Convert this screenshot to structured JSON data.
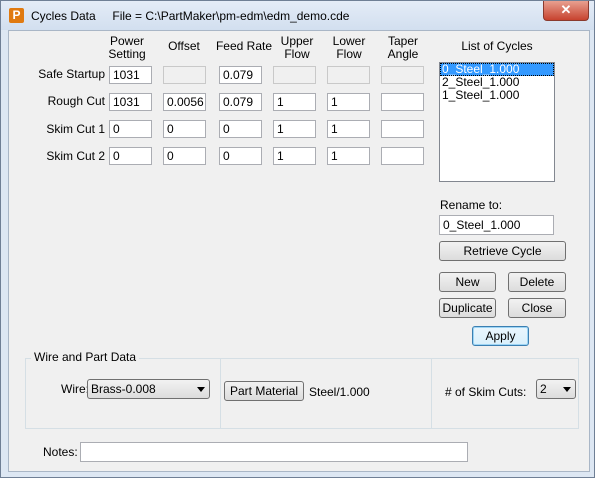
{
  "window": {
    "app_icon": "P",
    "title": "Cycles Data     File = C:\\PartMaker\\pm-edm\\edm_demo.cde",
    "close_glyph": "✕"
  },
  "headers": {
    "power": [
      "Power",
      "Setting"
    ],
    "offset": "Offset",
    "feed_rate": "Feed Rate",
    "upper_flow": [
      "Upper",
      "Flow"
    ],
    "lower_flow": [
      "Lower",
      "Flow"
    ],
    "taper_angle": [
      "Taper",
      "Angle"
    ]
  },
  "rows": [
    {
      "label": "Safe Startup",
      "power": "1031",
      "offset": "",
      "feed_rate": "0.079",
      "upper_flow": "",
      "lower_flow": "",
      "taper_angle": ""
    },
    {
      "label": "Rough Cut",
      "power": "1031",
      "offset": "0.0056",
      "feed_rate": "0.079",
      "upper_flow": "1",
      "lower_flow": "1",
      "taper_angle": ""
    },
    {
      "label": "Skim Cut 1",
      "power": "0",
      "offset": "0",
      "feed_rate": "0",
      "upper_flow": "1",
      "lower_flow": "1",
      "taper_angle": ""
    },
    {
      "label": "Skim Cut 2",
      "power": "0",
      "offset": "0",
      "feed_rate": "0",
      "upper_flow": "1",
      "lower_flow": "1",
      "taper_angle": ""
    }
  ],
  "cycles": {
    "title": "List of Cycles",
    "items": [
      "0_Steel_1.000",
      "2_Steel_1.000",
      "1_Steel_1.000"
    ],
    "selected_index": 0
  },
  "rename": {
    "label": "Rename to:",
    "value": "0_Steel_1.000"
  },
  "buttons": {
    "retrieve": "Retrieve Cycle",
    "new": "New",
    "delete": "Delete",
    "duplicate": "Duplicate",
    "close": "Close",
    "apply": "Apply"
  },
  "wire_part": {
    "group_title": "Wire and Part Data",
    "wire_label": "Wire:",
    "wire_value": "Brass-0.008",
    "part_material_button": "Part Material",
    "part_material_value": "Steel/1.000",
    "skim_cuts_label": "# of Skim Cuts:",
    "skim_cuts_value": "2"
  },
  "notes": {
    "label": "Notes:",
    "value": ""
  }
}
